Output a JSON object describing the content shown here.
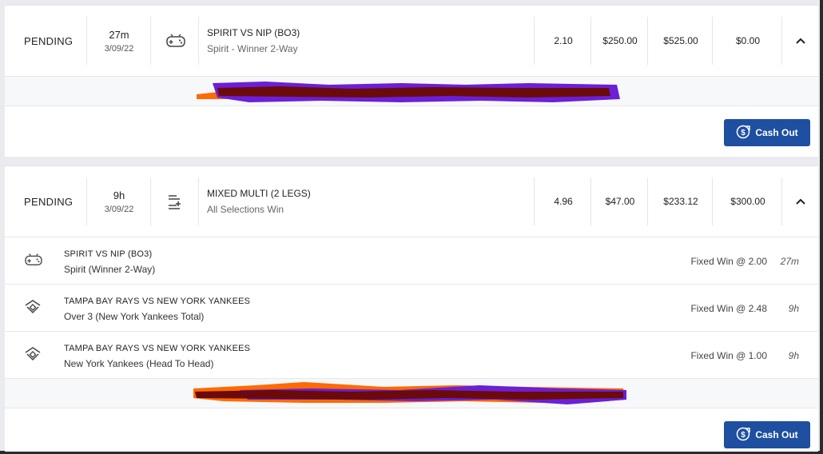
{
  "bets": [
    {
      "status": "PENDING",
      "time_ago": "27m",
      "date": "3/09/22",
      "sport_icon": "gamepad-icon",
      "event_title": "SPIRIT VS NIP (BO3)",
      "selection": "Spirit - Winner 2-Way",
      "odds": "2.10",
      "stake": "$250.00",
      "returns": "$525.00",
      "cash_value": "$0.00",
      "cashout_label": "Cash Out"
    },
    {
      "status": "PENDING",
      "time_ago": "9h",
      "date": "3/09/22",
      "sport_icon": "multi-bet-icon",
      "event_title": "MIXED MULTI (2 LEGS)",
      "selection": "All Selections Win",
      "odds": "4.96",
      "stake": "$47.00",
      "returns": "$233.12",
      "cash_value": "$300.00",
      "cashout_label": "Cash Out",
      "legs": [
        {
          "icon": "gamepad-icon",
          "title": "SPIRIT VS NIP (BO3)",
          "selection": "Spirit (Winner 2-Way)",
          "price": "Fixed Win @ 2.00",
          "time": "27m"
        },
        {
          "icon": "baseball-diamond-icon",
          "title": "TAMPA BAY RAYS VS NEW YORK YANKEES",
          "selection": "Over 3 (New York Yankees Total)",
          "price": "Fixed Win @ 2.48",
          "time": "9h"
        },
        {
          "icon": "baseball-diamond-icon",
          "title": "TAMPA BAY RAYS VS NEW YORK YANKEES",
          "selection": "New York Yankees (Head To Head)",
          "price": "Fixed Win @ 1.00",
          "time": "9h"
        }
      ]
    }
  ],
  "colors": {
    "button_blue": "#1e4fa0",
    "redact_dark": "#6b0a0a",
    "redact_purple": "#6b1fd6",
    "redact_orange": "#ff6a00"
  }
}
